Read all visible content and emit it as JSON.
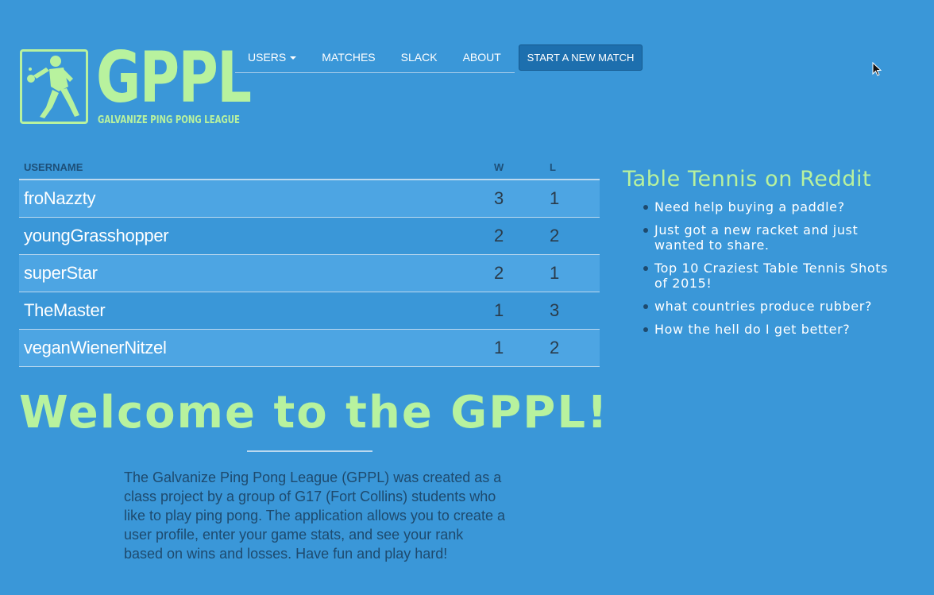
{
  "logo": {
    "title": "GPPL",
    "subtitle": "GALVANIZE PING PONG LEAGUE",
    "icon": "ping-pong-player-icon"
  },
  "nav": {
    "items": [
      {
        "label": "USERS",
        "dropdown": true
      },
      {
        "label": "MATCHES",
        "dropdown": false
      },
      {
        "label": "SLACK",
        "dropdown": false
      },
      {
        "label": "ABOUT",
        "dropdown": false
      }
    ],
    "start_button": "START A NEW MATCH"
  },
  "leaderboard": {
    "headers": {
      "username": "USERNAME",
      "wins": "W",
      "losses": "L"
    },
    "rows": [
      {
        "username": "froNazzty",
        "w": "3",
        "l": "1"
      },
      {
        "username": "youngGrasshopper",
        "w": "2",
        "l": "2"
      },
      {
        "username": "superStar",
        "w": "2",
        "l": "1"
      },
      {
        "username": "TheMaster",
        "w": "1",
        "l": "3"
      },
      {
        "username": "veganWienerNitzel",
        "w": "1",
        "l": "2"
      }
    ]
  },
  "reddit": {
    "title": "Table Tennis on Reddit",
    "items": [
      "Need help buying a paddle?",
      "Just got a new racket and just wanted to share.",
      "Top 10 Craziest Table Tennis Shots of 2015!",
      "what countries produce rubber?",
      "How the hell do I get better?"
    ]
  },
  "welcome": {
    "title": "Welcome to the GPPL!",
    "body": "The Galvanize Ping Pong League (GPPL) was created as a class project by a group of G17 (Fort Collins) students who like to play ping pong. The application allows you to create a user profile, enter your game stats, and see your rank based on wins and losses. Have fun and play hard!"
  },
  "colors": {
    "background": "#3a97d8",
    "accent_green": "#b8f29e",
    "button_blue": "#1d6fae",
    "row_highlight": "#4da5e3",
    "dark_text": "#1e4a6e"
  }
}
